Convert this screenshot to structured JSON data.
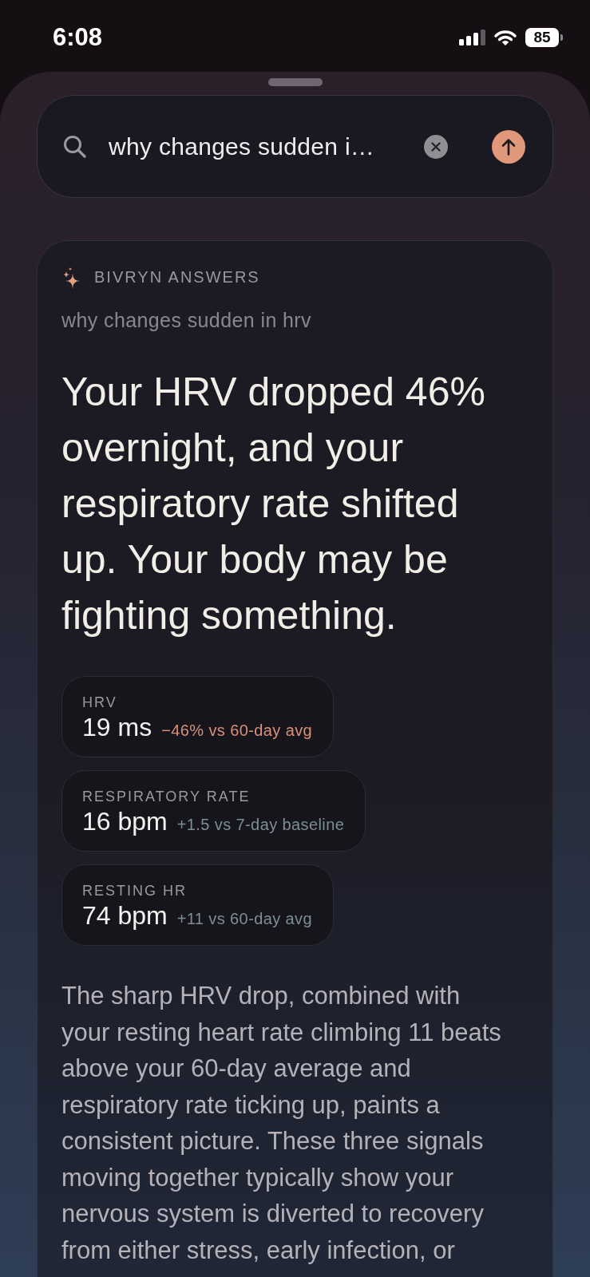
{
  "status_bar": {
    "time": "6:08",
    "battery": "85"
  },
  "search": {
    "value": "why changes sudden i…"
  },
  "answer": {
    "brand": "BIVRYN ANSWERS",
    "query": "why changes sudden in hrv",
    "headline": "Your HRV dropped 46% overnight, and your respiratory rate shifted up. Your body may be fighting something.",
    "metrics": [
      {
        "label": "HRV",
        "value": "19 ms",
        "change": "−46% vs 60-day avg",
        "color": "#d9917a"
      },
      {
        "label": "RESPIRATORY RATE",
        "value": "16 bpm",
        "change": "+1.5 vs 7-day baseline",
        "color": "#7d8e96"
      },
      {
        "label": "RESTING HR",
        "value": "74 bpm",
        "change": "+11 vs 60-day avg",
        "color": "#7d8e96"
      }
    ],
    "body": "The sharp HRV drop, combined with your resting heart rate climbing 11 beats above your 60-day average and respiratory rate ticking up, paints a consistent picture. These three signals moving together typically show your nervous system is diverted to recovery from either stress, early infection, or"
  }
}
